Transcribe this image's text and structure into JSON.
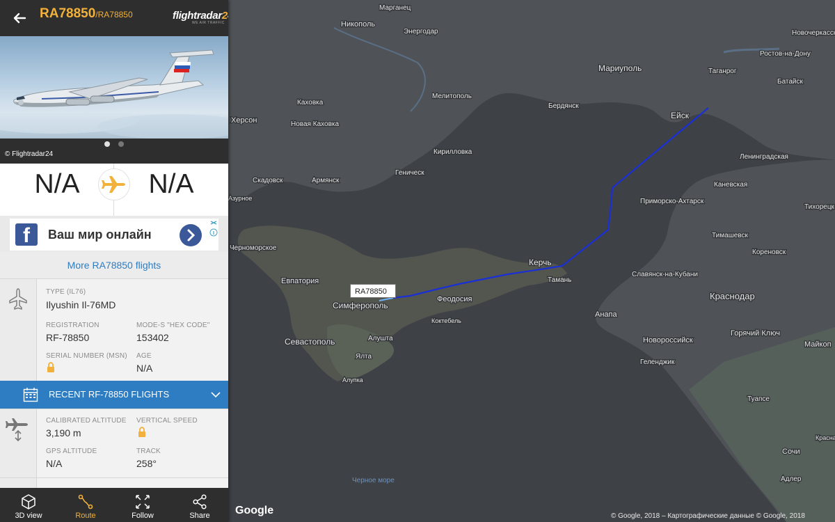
{
  "header": {
    "callsign": "RA78850",
    "callsign_secondary": "/RA78850",
    "brand_name": "flightradar",
    "brand_number": "24",
    "brand_tagline": "WE AIR TRAFFIC"
  },
  "photo": {
    "credit": "© Flightradar24",
    "pages": 2,
    "active_page": 1
  },
  "route": {
    "origin": "N/A",
    "destination": "N/A"
  },
  "ad": {
    "text": "Ваш мир онлайн",
    "logo_letter": "f"
  },
  "more_flights_label": "More RA78850 flights",
  "aircraft": {
    "type_label": "TYPE",
    "type_code": "(IL76)",
    "type_value": "Ilyushin Il-76MD",
    "registration_label": "REGISTRATION",
    "registration_value": "RF-78850",
    "hex_label": "MODE-S \"HEX CODE\"",
    "hex_value": "153402",
    "serial_label": "SERIAL NUMBER (MSN)",
    "age_label": "AGE",
    "age_value": "N/A"
  },
  "recent_flights_label": "RECENT RF-78850 FLIGHTS",
  "telemetry": {
    "cal_alt_label": "CALIBRATED ALTITUDE",
    "cal_alt_value": "3,190 m",
    "vs_label": "VERTICAL SPEED",
    "gps_alt_label": "GPS ALTITUDE",
    "gps_alt_value": "N/A",
    "track_label": "TRACK",
    "track_value": "258°"
  },
  "toolbar": [
    {
      "label": "3D view",
      "icon": "cube-icon",
      "active": false
    },
    {
      "label": "Route",
      "icon": "route-icon",
      "active": true
    },
    {
      "label": "Follow",
      "icon": "follow-icon",
      "active": false
    },
    {
      "label": "Share",
      "icon": "share-icon",
      "active": false
    }
  ],
  "map": {
    "aircraft_tag": "RA78850",
    "copyright": "© Google, 2018 – Картографические данные © Google, 2018",
    "google_logo": "Google",
    "labels": [
      "Марганец",
      "Никополь",
      "Энергодар",
      "Новочеркасск",
      "Ростов-на-Дону",
      "Таганрог",
      "Батайск",
      "Мариуполь",
      "Каховка",
      "Мелитополь",
      "Бердянск",
      "Херсон",
      "Новая Каховка",
      "Ейск",
      "Кирилловка",
      "Ленинградская",
      "Геническ",
      "Скадовск",
      "Армянск",
      "Каневская",
      "Тихорецк",
      "Приморско-Ахтарск",
      "Черноморское",
      "Тимашевск",
      "Кореновск",
      "Керчь",
      "Славянск-на-Кубани",
      "Евпатория",
      "Тамань",
      "Краснодар",
      "Симферополь",
      "Феодосия",
      "Анапа",
      "Коктебель",
      "Горячий Ключ",
      "Севастополь",
      "Алушта",
      "Новороссийск",
      "Майкоп",
      "Ялта",
      "Геленджик",
      "Алупка",
      "Туапсе",
      "Сочи",
      "Черное море",
      "Адлер",
      "Азурное",
      "Красная Поляна"
    ]
  },
  "colors": {
    "accent": "#f2b13a",
    "link": "#2e7cc1",
    "dark": "#2e2e2e",
    "track": "#1a2fd6"
  }
}
